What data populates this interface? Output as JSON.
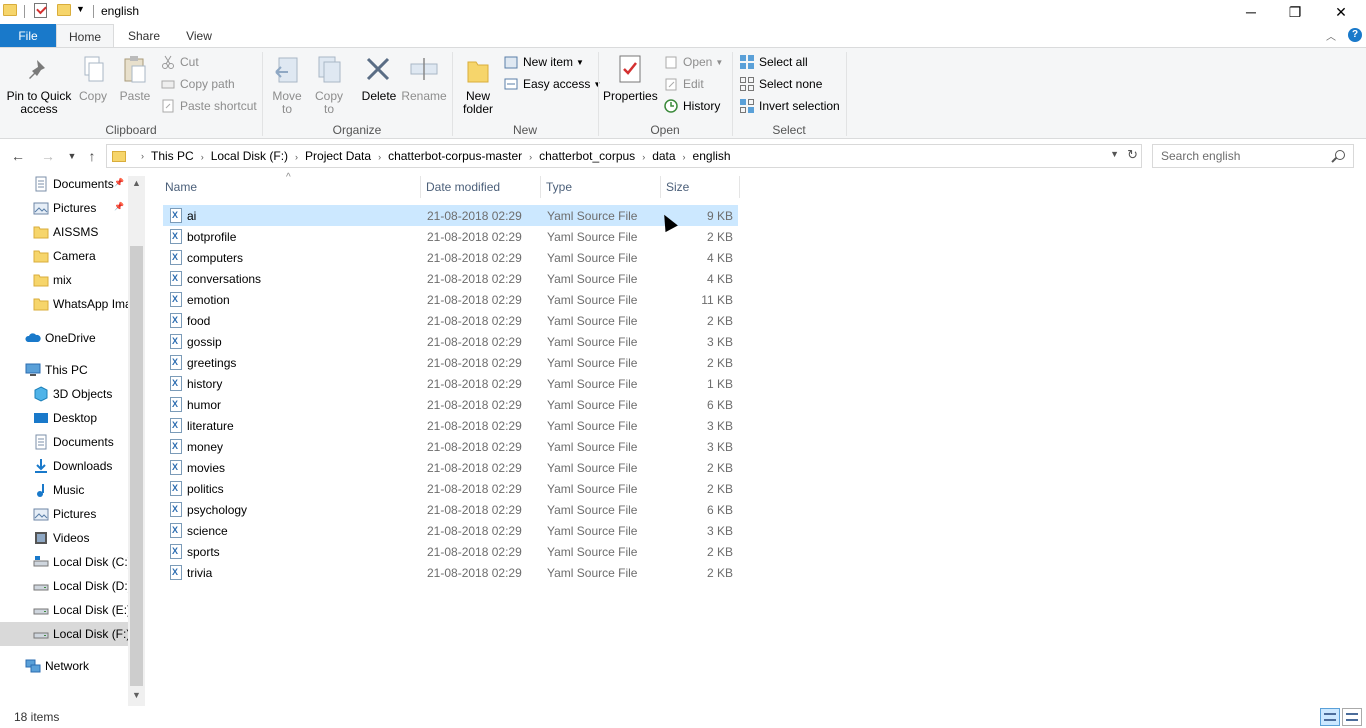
{
  "window": {
    "title": "english",
    "minimize_glyph": "─",
    "restore_glyph": "❐",
    "close_glyph": "✕"
  },
  "tabs": {
    "file": "File",
    "home": "Home",
    "share": "Share",
    "view": "View",
    "help": "?"
  },
  "ribbon": {
    "clipboard": {
      "label": "Clipboard",
      "pin": "Pin to Quick access",
      "copy": "Copy",
      "paste": "Paste",
      "cut": "Cut",
      "copy_path": "Copy path",
      "paste_shortcut": "Paste shortcut"
    },
    "organize": {
      "label": "Organize",
      "move_to": "Move to",
      "copy_to": "Copy to",
      "delete": "Delete",
      "rename": "Rename"
    },
    "new": {
      "label": "New",
      "new_folder": "New folder",
      "new_item": "New item",
      "easy_access": "Easy access"
    },
    "open": {
      "label": "Open",
      "properties": "Properties",
      "open": "Open",
      "edit": "Edit",
      "history": "History"
    },
    "select": {
      "label": "Select",
      "select_all": "Select all",
      "select_none": "Select none",
      "invert_selection": "Invert selection"
    }
  },
  "address": {
    "breadcrumbs": [
      "This PC",
      "Local Disk (F:)",
      "Project Data",
      "chatterbot-corpus-master",
      "chatterbot_corpus",
      "data",
      "english"
    ],
    "search_placeholder": "Search english"
  },
  "navpane": {
    "quick_access": [
      "Documents",
      "Pictures",
      "AISSMS",
      "Camera",
      "mix",
      "WhatsApp Ima"
    ],
    "onedrive": "OneDrive",
    "this_pc": "This PC",
    "pc_items": [
      "3D Objects",
      "Desktop",
      "Documents",
      "Downloads",
      "Music",
      "Pictures",
      "Videos",
      "Local Disk (C:)",
      "Local Disk (D:)",
      "Local Disk (E:)",
      "Local Disk (F:)"
    ],
    "network": "Network"
  },
  "columns": {
    "name": "Name",
    "date": "Date modified",
    "type": "Type",
    "size": "Size"
  },
  "files": [
    {
      "name": "ai",
      "date": "21-08-2018 02:29",
      "type": "Yaml Source File",
      "size": "9 KB"
    },
    {
      "name": "botprofile",
      "date": "21-08-2018 02:29",
      "type": "Yaml Source File",
      "size": "2 KB"
    },
    {
      "name": "computers",
      "date": "21-08-2018 02:29",
      "type": "Yaml Source File",
      "size": "4 KB"
    },
    {
      "name": "conversations",
      "date": "21-08-2018 02:29",
      "type": "Yaml Source File",
      "size": "4 KB"
    },
    {
      "name": "emotion",
      "date": "21-08-2018 02:29",
      "type": "Yaml Source File",
      "size": "11 KB"
    },
    {
      "name": "food",
      "date": "21-08-2018 02:29",
      "type": "Yaml Source File",
      "size": "2 KB"
    },
    {
      "name": "gossip",
      "date": "21-08-2018 02:29",
      "type": "Yaml Source File",
      "size": "3 KB"
    },
    {
      "name": "greetings",
      "date": "21-08-2018 02:29",
      "type": "Yaml Source File",
      "size": "2 KB"
    },
    {
      "name": "history",
      "date": "21-08-2018 02:29",
      "type": "Yaml Source File",
      "size": "1 KB"
    },
    {
      "name": "humor",
      "date": "21-08-2018 02:29",
      "type": "Yaml Source File",
      "size": "6 KB"
    },
    {
      "name": "literature",
      "date": "21-08-2018 02:29",
      "type": "Yaml Source File",
      "size": "3 KB"
    },
    {
      "name": "money",
      "date": "21-08-2018 02:29",
      "type": "Yaml Source File",
      "size": "3 KB"
    },
    {
      "name": "movies",
      "date": "21-08-2018 02:29",
      "type": "Yaml Source File",
      "size": "2 KB"
    },
    {
      "name": "politics",
      "date": "21-08-2018 02:29",
      "type": "Yaml Source File",
      "size": "2 KB"
    },
    {
      "name": "psychology",
      "date": "21-08-2018 02:29",
      "type": "Yaml Source File",
      "size": "6 KB"
    },
    {
      "name": "science",
      "date": "21-08-2018 02:29",
      "type": "Yaml Source File",
      "size": "3 KB"
    },
    {
      "name": "sports",
      "date": "21-08-2018 02:29",
      "type": "Yaml Source File",
      "size": "2 KB"
    },
    {
      "name": "trivia",
      "date": "21-08-2018 02:29",
      "type": "Yaml Source File",
      "size": "2 KB"
    }
  ],
  "status": {
    "count": "18 items"
  },
  "colors": {
    "accent": "#1979ca",
    "selection": "#cce8ff",
    "ribbon_bg": "#f5f6f7"
  }
}
